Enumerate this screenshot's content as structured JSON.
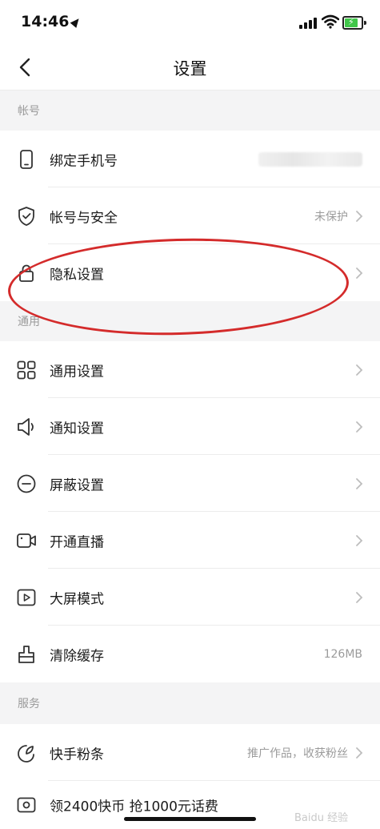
{
  "status_bar": {
    "time": "14:46"
  },
  "nav": {
    "title": "设置"
  },
  "sections": [
    {
      "header": "帐号",
      "items": [
        {
          "label": "绑定手机号",
          "value": "",
          "icon": "phone-icon",
          "chevron": false,
          "masked_value": true
        },
        {
          "label": "帐号与安全",
          "value": "未保护",
          "icon": "shield-icon",
          "chevron": true
        },
        {
          "label": "隐私设置",
          "value": "",
          "icon": "lock-icon",
          "chevron": true
        }
      ]
    },
    {
      "header": "通用",
      "items": [
        {
          "label": "通用设置",
          "value": "",
          "icon": "grid-icon",
          "chevron": true
        },
        {
          "label": "通知设置",
          "value": "",
          "icon": "speaker-icon",
          "chevron": true
        },
        {
          "label": "屏蔽设置",
          "value": "",
          "icon": "block-icon",
          "chevron": true
        },
        {
          "label": "开通直播",
          "value": "",
          "icon": "camera-icon",
          "chevron": true
        },
        {
          "label": "大屏模式",
          "value": "",
          "icon": "play-screen-icon",
          "chevron": true
        },
        {
          "label": "清除缓存",
          "value": "126MB",
          "icon": "brush-icon",
          "chevron": false
        }
      ]
    },
    {
      "header": "服务",
      "items": [
        {
          "label": "快手粉条",
          "value": "推广作品，收获粉丝",
          "icon": "fan-icon",
          "chevron": true
        },
        {
          "label": "领2400快币 抢1000元话费",
          "value": "",
          "icon": "coin-icon",
          "chevron": false
        }
      ]
    }
  ],
  "annotation": {
    "color": "#d42b2b",
    "target": "隐私设置"
  },
  "watermark": "Baidu 经验",
  "colors": {
    "section_bg": "#f4f4f5",
    "divider": "#ececec",
    "secondary_text": "#9b9b9b",
    "battery": "#41c74a"
  }
}
